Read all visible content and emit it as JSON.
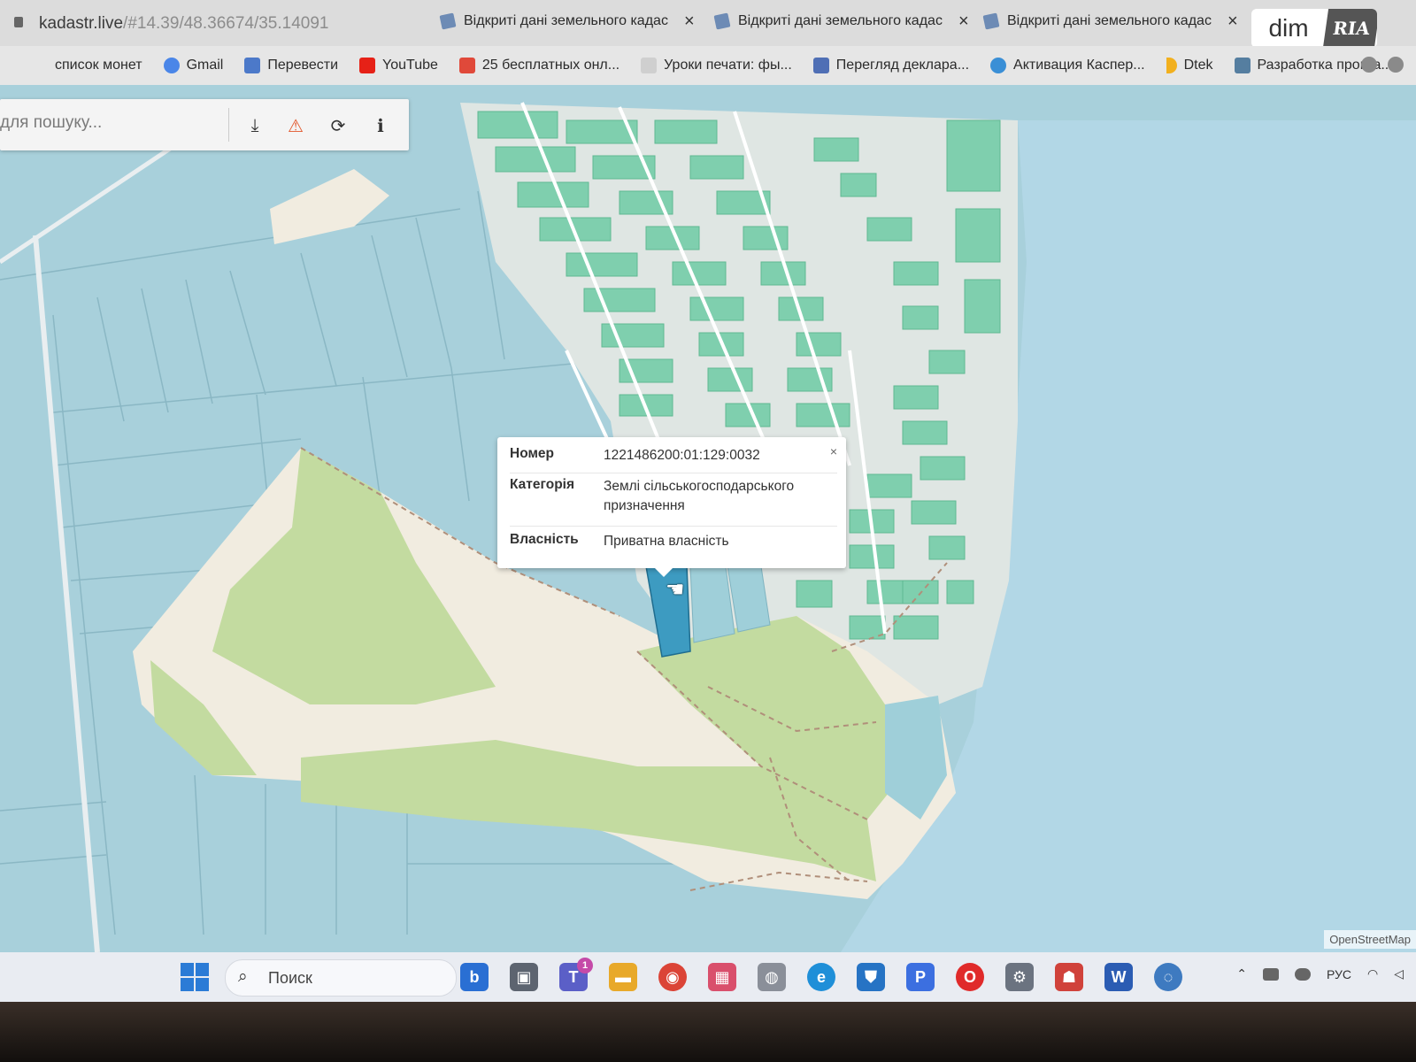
{
  "browser": {
    "url_host": "kadastr.live",
    "url_fragment": "/#14.39/48.36674/35.14091",
    "tabs": [
      {
        "title": "Відкриті дані земельного кадас"
      },
      {
        "title": "Відкриті дані земельного кадас"
      },
      {
        "title": "Відкриті дані земельного кадас"
      }
    ],
    "tab_close": "×",
    "logo_left": "dim",
    "logo_right": "RIA"
  },
  "bookmarks": [
    {
      "label": "список монет",
      "color": "#e6e6e6"
    },
    {
      "label": "Gmail",
      "color": "#4a86e8"
    },
    {
      "label": "Перевести",
      "color": "#4c79c9"
    },
    {
      "label": "YouTube",
      "color": "#e62117"
    },
    {
      "label": "25 бесплатных онл...",
      "color": "#e0493a"
    },
    {
      "label": "Уроки печати: фы...",
      "color": "#cfcfcf"
    },
    {
      "label": "Перегляд деклара...",
      "color": "#4f6fb5"
    },
    {
      "label": "Активация Каспер...",
      "color": "#3a8fd6"
    },
    {
      "label": "Dtek",
      "color": "#f2b01e"
    },
    {
      "label": "Разработка програ...",
      "color": "#557ea0"
    }
  ],
  "map_toolbar": {
    "search_placeholder": "для пошуку...",
    "tools": [
      {
        "name": "download-icon",
        "glyph": "⤓"
      },
      {
        "name": "warning-icon",
        "glyph": "⚠"
      },
      {
        "name": "refresh-icon",
        "glyph": "⟳"
      },
      {
        "name": "info-icon",
        "glyph": "ℹ"
      }
    ]
  },
  "popup": {
    "close": "×",
    "rows": [
      {
        "key": "Номер",
        "value": "1221486200:01:129:0032"
      },
      {
        "key": "Категорія",
        "value": "Землі сільськогосподарського призначення"
      },
      {
        "key": "Власність",
        "value": "Приватна власність"
      }
    ]
  },
  "map": {
    "attribution": "OpenStreetMap",
    "colors": {
      "agri": "#a8d0db",
      "private": "#7fcfae",
      "water": "#b2d7e6",
      "forest": "#c3dba0",
      "sand": "#f1ece0",
      "selected": "#3d9bc1"
    }
  },
  "taskbar": {
    "search_label": "Поиск",
    "notification_count": "1",
    "apps": [
      {
        "name": "bing-icon",
        "glyph": "b",
        "color": "#2a6fd3"
      },
      {
        "name": "task-view-icon",
        "glyph": "▣",
        "color": "#5d6470"
      },
      {
        "name": "teams-icon",
        "glyph": "T",
        "color": "#5b5fc7"
      },
      {
        "name": "explorer-icon",
        "glyph": "▬",
        "color": "#e8a92a"
      },
      {
        "name": "chrome-icon",
        "glyph": "◉",
        "color": "#db4437"
      },
      {
        "name": "store-icon",
        "glyph": "▦",
        "color": "#d94f6c"
      },
      {
        "name": "mouse-icon",
        "glyph": "◍",
        "color": "#8a8f99"
      },
      {
        "name": "edge-icon",
        "glyph": "e",
        "color": "#1f8fd8"
      },
      {
        "name": "defender-icon",
        "glyph": "⛊",
        "color": "#2673c4"
      },
      {
        "name": "p-app-icon",
        "glyph": "P",
        "color": "#3c6fe0"
      },
      {
        "name": "opera-icon",
        "glyph": "O",
        "color": "#e02a2a"
      },
      {
        "name": "settings-icon",
        "glyph": "⚙",
        "color": "#6b7380"
      },
      {
        "name": "game-icon",
        "glyph": "☗",
        "color": "#d0423b"
      },
      {
        "name": "word-icon",
        "glyph": "W",
        "color": "#2b5cb3"
      },
      {
        "name": "cortana-icon",
        "glyph": "◌",
        "color": "#3e7ac0"
      }
    ],
    "language": "РУС"
  }
}
